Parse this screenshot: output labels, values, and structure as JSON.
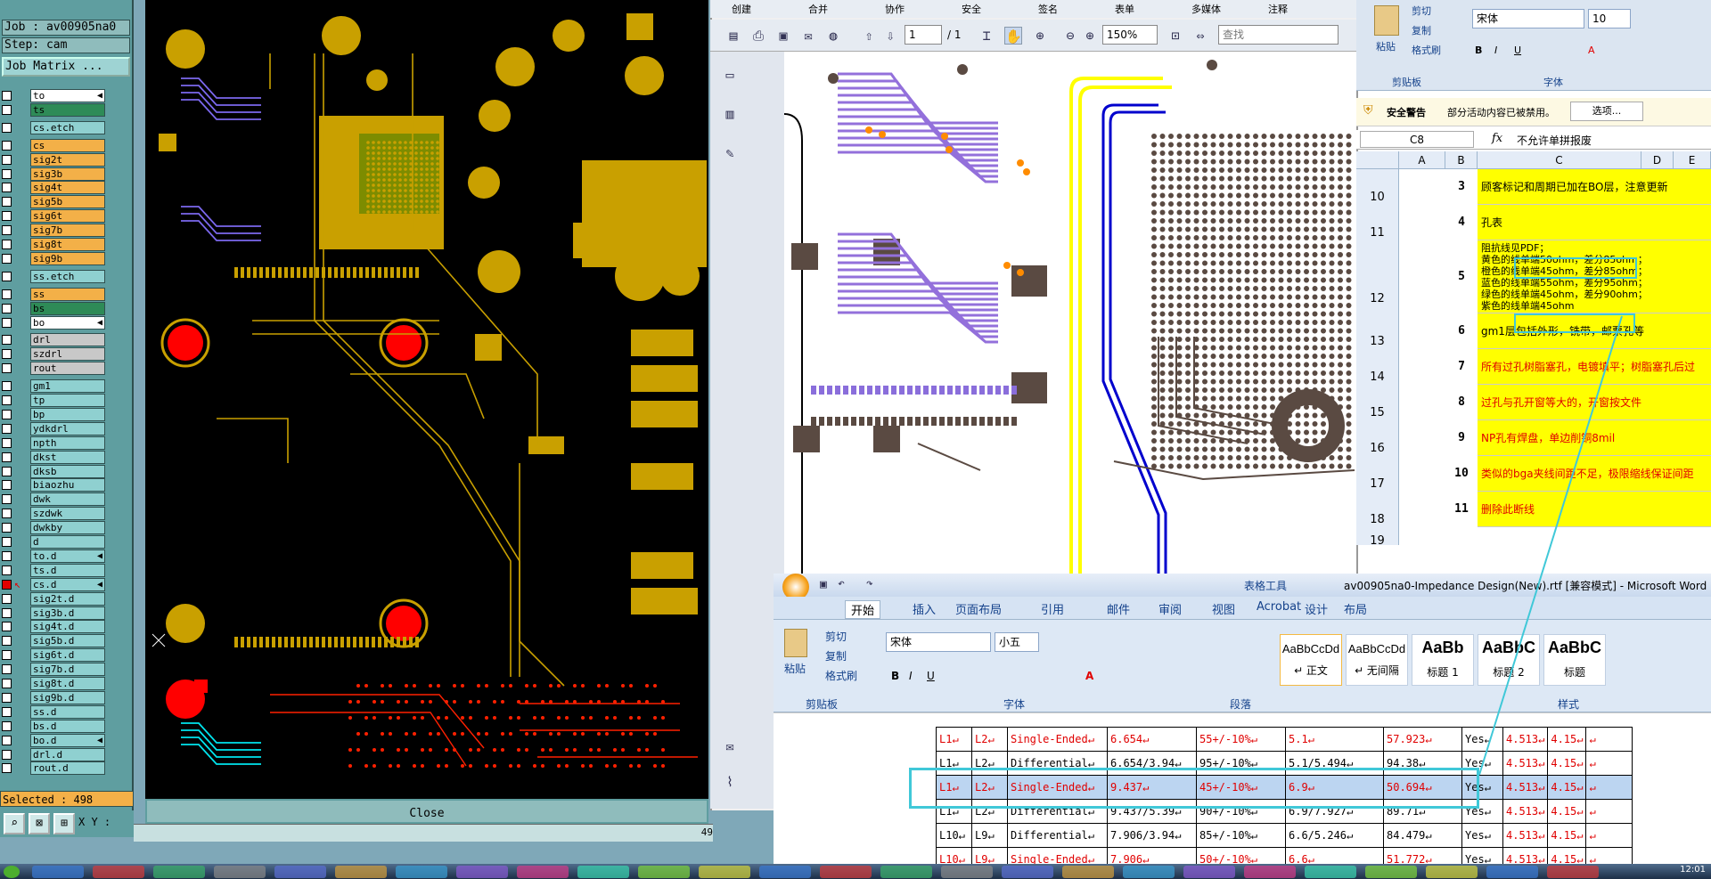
{
  "cam": {
    "job": "Job : av00905na0",
    "step": "Step: cam",
    "job_matrix": "Job Matrix ...",
    "selected": "Selected : 498",
    "xy_label": "X Y :",
    "close": "Close",
    "edge_number": "49",
    "layers": [
      {
        "name": "to",
        "color": "white",
        "arrow": "◀"
      },
      {
        "name": "ts",
        "color": "teal",
        "arrow": ""
      },
      {
        "name": "cs.etch",
        "color": "cyan",
        "arrow": ""
      },
      {
        "name": "cs",
        "color": "orange",
        "arrow": ""
      },
      {
        "name": "sig2t",
        "color": "orange",
        "arrow": ""
      },
      {
        "name": "sig3b",
        "color": "orange",
        "arrow": ""
      },
      {
        "name": "sig4t",
        "color": "orange",
        "arrow": ""
      },
      {
        "name": "sig5b",
        "color": "orange",
        "arrow": ""
      },
      {
        "name": "sig6t",
        "color": "orange",
        "arrow": ""
      },
      {
        "name": "sig7b",
        "color": "orange",
        "arrow": ""
      },
      {
        "name": "sig8t",
        "color": "orange",
        "arrow": ""
      },
      {
        "name": "sig9b",
        "color": "orange",
        "arrow": ""
      },
      {
        "name": "ss.etch",
        "color": "cyan",
        "arrow": ""
      },
      {
        "name": "ss",
        "color": "orange",
        "arrow": ""
      },
      {
        "name": "bs",
        "color": "teal",
        "arrow": ""
      },
      {
        "name": "bo",
        "color": "white",
        "arrow": "◀"
      },
      {
        "name": "drl",
        "color": "gray",
        "arrow": ""
      },
      {
        "name": "szdrl",
        "color": "gray",
        "arrow": ""
      },
      {
        "name": "rout",
        "color": "gray",
        "arrow": ""
      },
      {
        "name": "gm1",
        "color": "cyan",
        "arrow": ""
      },
      {
        "name": "tp",
        "color": "cyan",
        "arrow": ""
      },
      {
        "name": "bp",
        "color": "cyan",
        "arrow": ""
      },
      {
        "name": "ydkdrl",
        "color": "cyan",
        "arrow": ""
      },
      {
        "name": "npth",
        "color": "cyan",
        "arrow": ""
      },
      {
        "name": "dkst",
        "color": "cyan",
        "arrow": ""
      },
      {
        "name": "dksb",
        "color": "cyan",
        "arrow": ""
      },
      {
        "name": "biaozhu",
        "color": "cyan",
        "arrow": ""
      },
      {
        "name": "dwk",
        "color": "cyan",
        "arrow": ""
      },
      {
        "name": "szdwk",
        "color": "cyan",
        "arrow": ""
      },
      {
        "name": "dwkby",
        "color": "cyan",
        "arrow": ""
      },
      {
        "name": "d",
        "color": "cyan",
        "arrow": ""
      },
      {
        "name": "to.d",
        "color": "cyan",
        "arrow": "◀"
      },
      {
        "name": "ts.d",
        "color": "cyan",
        "arrow": ""
      },
      {
        "name": "cs.d",
        "color": "cyan",
        "arrow": "◀"
      },
      {
        "name": "sig2t.d",
        "color": "cyan",
        "arrow": ""
      },
      {
        "name": "sig3b.d",
        "color": "cyan",
        "arrow": ""
      },
      {
        "name": "sig4t.d",
        "color": "cyan",
        "arrow": ""
      },
      {
        "name": "sig5b.d",
        "color": "cyan",
        "arrow": ""
      },
      {
        "name": "sig6t.d",
        "color": "cyan",
        "arrow": ""
      },
      {
        "name": "sig7b.d",
        "color": "cyan",
        "arrow": ""
      },
      {
        "name": "sig8t.d",
        "color": "cyan",
        "arrow": ""
      },
      {
        "name": "sig9b.d",
        "color": "cyan",
        "arrow": ""
      },
      {
        "name": "ss.d",
        "color": "cyan",
        "arrow": ""
      },
      {
        "name": "bs.d",
        "color": "cyan",
        "arrow": ""
      },
      {
        "name": "bo.d",
        "color": "cyan",
        "arrow": "◀"
      },
      {
        "name": "drl.d",
        "color": "cyan",
        "arrow": ""
      },
      {
        "name": "rout.d",
        "color": "cyan",
        "arrow": ""
      }
    ]
  },
  "reader": {
    "menu": [
      "创建",
      "合并",
      "协作",
      "安全",
      "签名",
      "表单",
      "多媒体",
      "注释"
    ],
    "page_current": "1",
    "page_total": "/ 1",
    "zoom": "150%",
    "search_placeholder": "查找"
  },
  "excel": {
    "clipboard": {
      "paste": "粘贴",
      "cut": "剪切",
      "copy": "复制",
      "format": "格式刷",
      "group": "剪贴板"
    },
    "font": {
      "name": "宋体",
      "size": "10",
      "group": "字体"
    },
    "security_title": "安全警告",
    "security_text": "部分活动内容已被禁用。",
    "options_button": "选项...",
    "name_box": "C8",
    "fx": "fx",
    "formula": "不允许单拼报废",
    "columns": [
      "A",
      "B",
      "C",
      "D",
      "E"
    ],
    "rows": [
      {
        "rownum": "10",
        "num": "3",
        "text": "顾客标记和周期已加在BO层，注意更新",
        "red": false
      },
      {
        "rownum": "11",
        "num": "4",
        "text": "孔表",
        "red": false
      },
      {
        "rownum": "12",
        "num": "5",
        "text": "",
        "red": false,
        "lines": [
          "阻抗线见PDF；",
          "黄色的线单端50ohm，差分85ohm；",
          "橙色的线单端45ohm，差分85ohm；",
          "蓝色的线单端55ohm，差分95ohm；",
          "绿色的线单端45ohm，差分90ohm；",
          "紫色的线单端45ohm"
        ]
      },
      {
        "rownum": "13",
        "num": "6",
        "text": "gm1层包括外形，铣带，邮票孔等",
        "red": false
      },
      {
        "rownum": "14",
        "num": "7",
        "text": "所有过孔树脂塞孔，电镀填平；树脂塞孔后过",
        "red": true
      },
      {
        "rownum": "15",
        "num": "8",
        "text": "过孔与孔开窗等大的，开窗按文件",
        "red": true
      },
      {
        "rownum": "16",
        "num": "9",
        "text": "NP孔有焊盘，单边削铜8mil",
        "red": true
      },
      {
        "rownum": "17",
        "num": "10",
        "text": "类似的bga夹线间距不足，极限缩线保证间距",
        "red": true
      },
      {
        "rownum": "18",
        "num": "11",
        "text": "删除此断线",
        "red": true
      },
      {
        "rownum": "19",
        "num": "",
        "text": "",
        "red": false
      }
    ]
  },
  "word": {
    "title": "av00905na0-Impedance Design(New).rtf [兼容模式] - Microsoft Word",
    "context_tab": "表格工具",
    "tabs": [
      "开始",
      "插入",
      "页面布局",
      "引用",
      "邮件",
      "审阅",
      "视图",
      "Acrobat",
      "设计",
      "布局"
    ],
    "clipboard": {
      "paste": "粘贴",
      "cut": "剪切",
      "copy": "复制",
      "format": "格式刷",
      "group": "剪贴板"
    },
    "font": {
      "name": "宋体",
      "size": "小五",
      "group": "字体"
    },
    "paragraph_group": "段落",
    "styles_group": "样式",
    "styles": [
      {
        "preview": "AaBbCcDd",
        "label": "↵ 正文"
      },
      {
        "preview": "AaBbCcDd",
        "label": "↵ 无间隔"
      },
      {
        "preview": "AaBb",
        "label": "标题 1"
      },
      {
        "preview": "AaBbC",
        "label": "标题 2"
      },
      {
        "preview": "AaBbC",
        "label": "标题"
      }
    ],
    "table_rows": [
      {
        "style": "red",
        "cells": [
          "L1↵",
          "L2↵",
          "Single-Ended↵",
          "6.654↵",
          "55+/-10%↵",
          "5.1↵",
          "57.923↵",
          "Yes↵",
          "4.513↵",
          "4.15↵",
          "↵"
        ]
      },
      {
        "style": "",
        "cells": [
          "L1↵",
          "L2↵",
          "Differential↵",
          "6.654/3.94↵",
          "95+/-10%↵",
          "5.1/5.494↵",
          "94.38↵",
          "Yes↵",
          "4.513↵",
          "4.15↵",
          "↵"
        ]
      },
      {
        "style": "hl red",
        "cells": [
          "L1↵",
          "L2↵",
          "Single-Ended↵",
          "9.437↵",
          "45+/-10%↵",
          "6.9↵",
          "50.694↵",
          "Yes↵",
          "4.513↵",
          "4.15↵",
          "↵"
        ]
      },
      {
        "style": "",
        "cells": [
          "L1↵",
          "L2↵",
          "Differential↵",
          "9.437/5.39↵",
          "90+/-10%↵",
          "6.9/7.927↵",
          "89.71↵",
          "Yes↵",
          "4.513↵",
          "4.15↵",
          "↵"
        ]
      },
      {
        "style": "",
        "cells": [
          "L10↵",
          "L9↵",
          "Differential↵",
          "7.906/3.94↵",
          "85+/-10%↵",
          "6.6/5.246↵",
          "84.479↵",
          "Yes↵",
          "4.513↵",
          "4.15↵",
          "↵"
        ]
      },
      {
        "style": "red",
        "cells": [
          "L10↵",
          "L9↵",
          "Single-Ended↵",
          "7.906↵",
          "50+/-10%↵",
          "6.6↵",
          "51.772↵",
          "Yes↵",
          "4.513↵",
          "4.15↵",
          "↵"
        ]
      }
    ]
  },
  "taskbar": {
    "clock": "12:01"
  }
}
